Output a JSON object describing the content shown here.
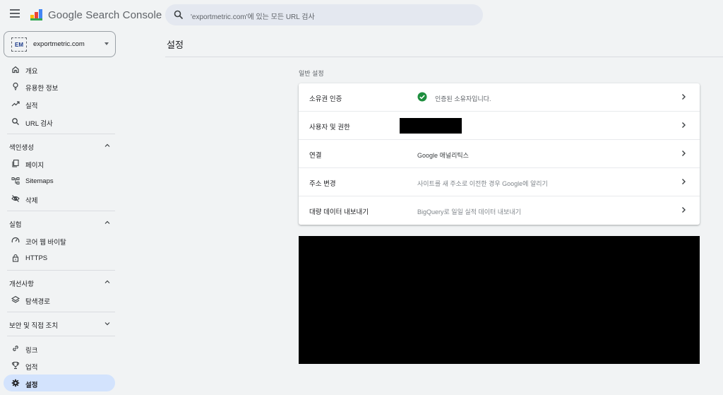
{
  "app": {
    "logo_text": "Google Search Console",
    "search_placeholder": "'exportmetric.com'에 있는 모든 URL 검사"
  },
  "property": {
    "favicon_text": "EM",
    "name": "exportmetric.com"
  },
  "sidebar": {
    "top_items": [
      {
        "label": "개요",
        "icon": "home-icon"
      },
      {
        "label": "유용한 정보",
        "icon": "lightbulb-icon"
      },
      {
        "label": "실적",
        "icon": "trending-up-icon"
      },
      {
        "label": "URL 검사",
        "icon": "search-icon"
      }
    ],
    "sections": [
      {
        "title": "색인생성",
        "expanded": true,
        "items": [
          {
            "label": "페이지",
            "icon": "pages-icon"
          },
          {
            "label": "Sitemaps",
            "icon": "sitemap-icon"
          },
          {
            "label": "삭제",
            "icon": "visibility-off-icon"
          }
        ]
      },
      {
        "title": "실험",
        "expanded": true,
        "items": [
          {
            "label": "코어 웹 바이탈",
            "icon": "speed-gauge-icon"
          },
          {
            "label": "HTTPS",
            "icon": "lock-icon"
          }
        ]
      },
      {
        "title": "개선사항",
        "expanded": true,
        "items": [
          {
            "label": "탐색경로",
            "icon": "layers-icon"
          }
        ]
      },
      {
        "title": "보안 및 직접 조치",
        "expanded": false,
        "items": []
      }
    ],
    "bottom_items": [
      {
        "label": "링크",
        "icon": "link-icon"
      },
      {
        "label": "업적",
        "icon": "trophy-icon"
      },
      {
        "label": "설정",
        "icon": "gear-icon",
        "active": true
      }
    ]
  },
  "main": {
    "title": "설정",
    "section_label": "일반 설정",
    "rows": [
      {
        "title": "소유권 인증",
        "value": "인증된 소유자입니다."
      },
      {
        "title": "사용자 및 권한",
        "value": ""
      },
      {
        "title": "연결",
        "value": "Google 애널리틱스"
      },
      {
        "title": "주소 변경",
        "value": "사이트를 새 주소로 이전한 경우 Google에 알리기"
      },
      {
        "title": "대량 데이터 내보내기",
        "value": "BigQuery로 일일 실적 데이터 내보내기"
      }
    ]
  },
  "colors": {
    "accent_active": "#d3e3fd",
    "check_green": "#1e8e3e",
    "background": "#f1f3f4"
  }
}
